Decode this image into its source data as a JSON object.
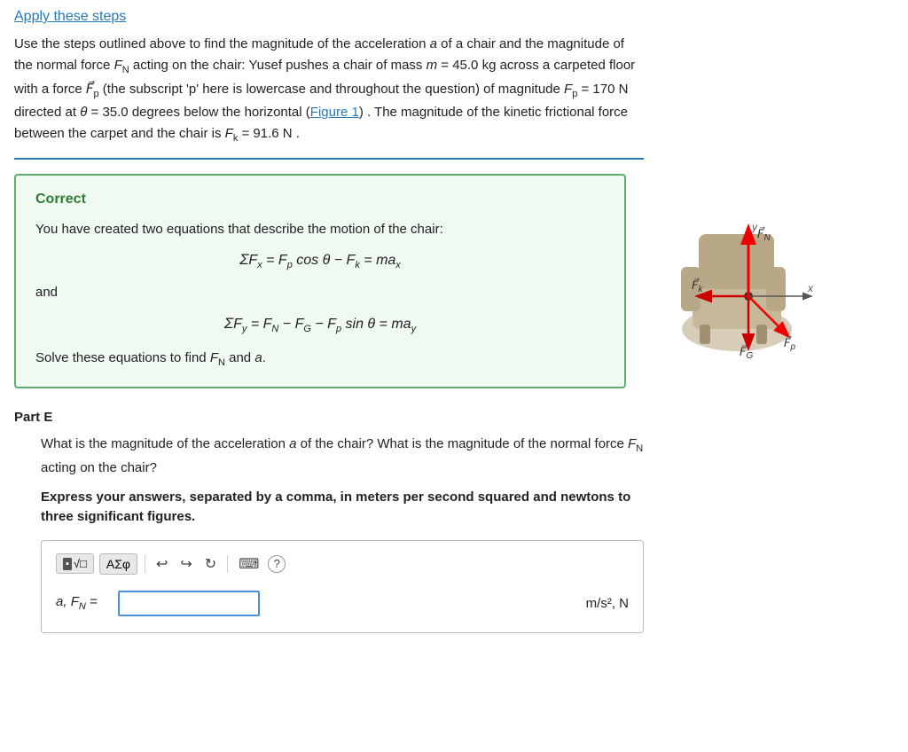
{
  "header": {
    "title": "Apply these steps"
  },
  "intro": {
    "text_line1": "Use the steps outlined above to find the magnitude of the acceleration ",
    "var_a": "a",
    "text_line2": " of a chair and the magnitude of the normal force ",
    "var_FN": "F",
    "sub_N": "N",
    "text_line3": " acting on the chair: Yusef pushes a chair of mass ",
    "var_m": "m",
    "text_eq_m": " = 45.0 kg across a carpeted floor with a force ",
    "var_Fp": "F",
    "sub_p": "p",
    "text_line4": " (the subscript 'p' here is lowercase and throughout the question) of magnitude ",
    "var_Fp2": "F",
    "sub_p2": "p",
    "text_eq_Fp": " = 170 N directed at ",
    "var_theta": "θ",
    "text_eq_theta": " = 35.0 degrees below the horizontal (",
    "figure_link": "Figure 1",
    "text_line5": ") . The magnitude of the kinetic frictional force between the carpet and the chair is ",
    "var_Fk": "F",
    "sub_k": "k",
    "text_eq_Fk": " = 91.6 N .",
    "colors": {
      "link": "#2a7ab8",
      "border": "#2a7ab8"
    }
  },
  "correct_box": {
    "title": "Correct",
    "desc": "You have created two equations that describe the motion of the chair:",
    "eq1": "ΣFₓ = Fₚ cosθ − Fₖ = maₓ",
    "eq1_display": "ΣF_x = F_p cos θ − F_k = ma_x",
    "and_label": "and",
    "eq2": "ΣFᵧ = F_N − F_G − F_p sin θ = ma_y",
    "eq2_display": "ΣF_y = F_N − F_G − F_p sin θ = ma_y",
    "solve": "Solve these equations to find ",
    "solve_var": "F",
    "solve_sub": "N",
    "solve_and": " and ",
    "solve_a": "a",
    "solve_end": "."
  },
  "part_e": {
    "label": "Part E",
    "question_line1": "What is the magnitude of the acceleration ",
    "q_var_a": "a",
    "question_line2": " of the chair? What is the magnitude of the normal force ",
    "q_var_FN": "F",
    "q_sub_N": "N",
    "question_line3": " acting on the chair?",
    "instruction": "Express your answers, separated by a comma, in meters per second squared and newtons to three significant figures.",
    "answer_label": "a, F",
    "answer_sub": "N",
    "answer_eq": " =",
    "unit": "m/s², N",
    "toolbar": {
      "block_icon": "▪",
      "sqrt_icon": "√□",
      "greek_btn": "ΑΣφ",
      "undo_icon": "↩",
      "redo_icon": "↪",
      "refresh_icon": "↻",
      "keyboard_icon": "⌨",
      "help_icon": "?"
    }
  },
  "diagram": {
    "labels": {
      "FN": "F⃗_N",
      "Fk": "F⃗_k",
      "FG": "F⃗_G",
      "Fp": "F⃗_p",
      "x_axis": "x",
      "y_axis": "y"
    }
  }
}
